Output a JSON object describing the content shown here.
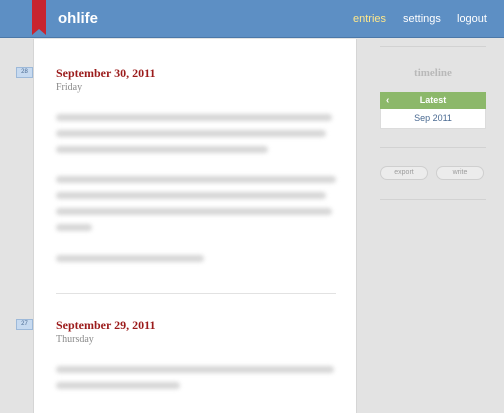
{
  "header": {
    "logo": "ohlife",
    "nav": {
      "entries": "entries",
      "settings": "settings",
      "logout": "logout"
    },
    "colors": {
      "bar": "#5d8fc4",
      "bookmark": "#c8242f",
      "active_nav": "#ffe88a"
    }
  },
  "entries": [
    {
      "day_number": "28",
      "date": "September 30, 2011",
      "weekday": "Friday"
    },
    {
      "day_number": "27",
      "date": "September 29, 2011",
      "weekday": "Thursday"
    }
  ],
  "sidebar": {
    "timeline_title": "timeline",
    "latest_label": "Latest",
    "latest_icon": "chevron-left-icon",
    "months": [
      "Sep 2011"
    ],
    "export_label": "export",
    "write_label": "write"
  }
}
